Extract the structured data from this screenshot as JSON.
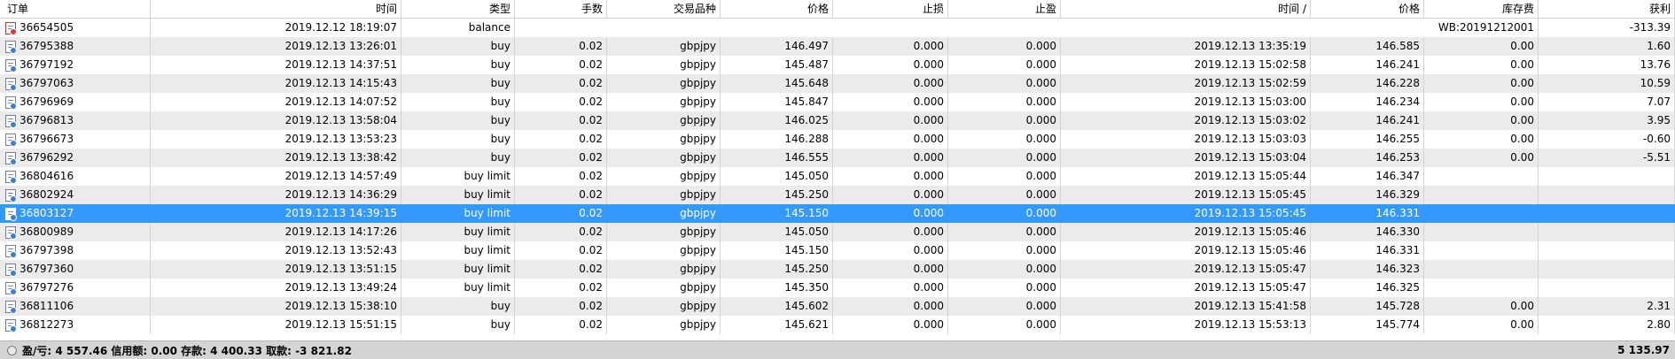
{
  "columns": [
    "订单",
    "时间",
    "类型",
    "手数",
    "交易品种",
    "价格",
    "止损",
    "止盈",
    "时间 /",
    "价格",
    "库存费",
    "获利"
  ],
  "balance_row": {
    "ticket": "36654505",
    "time": "2019.12.12 18:19:07",
    "type": "balance",
    "comment": "WB:20191212001",
    "profit": "-313.39"
  },
  "rows": [
    {
      "ticket": "36795388",
      "open_time": "2019.12.13 13:26:01",
      "type": "buy",
      "lots": "0.02",
      "symbol": "gbpjpy",
      "price": "146.497",
      "sl": "0.000",
      "tp": "0.000",
      "close_time": "2019.12.13 13:35:19",
      "close_price": "146.585",
      "swap": "0.00",
      "profit": "1.60"
    },
    {
      "ticket": "36797192",
      "open_time": "2019.12.13 14:37:51",
      "type": "buy",
      "lots": "0.02",
      "symbol": "gbpjpy",
      "price": "145.487",
      "sl": "0.000",
      "tp": "0.000",
      "close_time": "2019.12.13 15:02:58",
      "close_price": "146.241",
      "swap": "0.00",
      "profit": "13.76"
    },
    {
      "ticket": "36797063",
      "open_time": "2019.12.13 14:15:43",
      "type": "buy",
      "lots": "0.02",
      "symbol": "gbpjpy",
      "price": "145.648",
      "sl": "0.000",
      "tp": "0.000",
      "close_time": "2019.12.13 15:02:59",
      "close_price": "146.228",
      "swap": "0.00",
      "profit": "10.59"
    },
    {
      "ticket": "36796969",
      "open_time": "2019.12.13 14:07:52",
      "type": "buy",
      "lots": "0.02",
      "symbol": "gbpjpy",
      "price": "145.847",
      "sl": "0.000",
      "tp": "0.000",
      "close_time": "2019.12.13 15:03:00",
      "close_price": "146.234",
      "swap": "0.00",
      "profit": "7.07"
    },
    {
      "ticket": "36796813",
      "open_time": "2019.12.13 13:58:04",
      "type": "buy",
      "lots": "0.02",
      "symbol": "gbpjpy",
      "price": "146.025",
      "sl": "0.000",
      "tp": "0.000",
      "close_time": "2019.12.13 15:03:02",
      "close_price": "146.241",
      "swap": "0.00",
      "profit": "3.95"
    },
    {
      "ticket": "36796673",
      "open_time": "2019.12.13 13:53:23",
      "type": "buy",
      "lots": "0.02",
      "symbol": "gbpjpy",
      "price": "146.288",
      "sl": "0.000",
      "tp": "0.000",
      "close_time": "2019.12.13 15:03:03",
      "close_price": "146.255",
      "swap": "0.00",
      "profit": "-0.60"
    },
    {
      "ticket": "36796292",
      "open_time": "2019.12.13 13:38:42",
      "type": "buy",
      "lots": "0.02",
      "symbol": "gbpjpy",
      "price": "146.555",
      "sl": "0.000",
      "tp": "0.000",
      "close_time": "2019.12.13 15:03:04",
      "close_price": "146.253",
      "swap": "0.00",
      "profit": "-5.51"
    },
    {
      "ticket": "36804616",
      "open_time": "2019.12.13 14:57:49",
      "type": "buy limit",
      "lots": "0.02",
      "symbol": "gbpjpy",
      "price": "145.050",
      "sl": "0.000",
      "tp": "0.000",
      "close_time": "2019.12.13 15:05:44",
      "close_price": "146.347",
      "swap": "",
      "profit": ""
    },
    {
      "ticket": "36802924",
      "open_time": "2019.12.13 14:36:29",
      "type": "buy limit",
      "lots": "0.02",
      "symbol": "gbpjpy",
      "price": "145.250",
      "sl": "0.000",
      "tp": "0.000",
      "close_time": "2019.12.13 15:05:45",
      "close_price": "146.329",
      "swap": "",
      "profit": ""
    },
    {
      "ticket": "36803127",
      "open_time": "2019.12.13 14:39:15",
      "type": "buy limit",
      "lots": "0.02",
      "symbol": "gbpjpy",
      "price": "145.150",
      "sl": "0.000",
      "tp": "0.000",
      "close_time": "2019.12.13 15:05:45",
      "close_price": "146.331",
      "swap": "",
      "profit": "",
      "selected": true
    },
    {
      "ticket": "36800989",
      "open_time": "2019.12.13 14:17:26",
      "type": "buy limit",
      "lots": "0.02",
      "symbol": "gbpjpy",
      "price": "145.050",
      "sl": "0.000",
      "tp": "0.000",
      "close_time": "2019.12.13 15:05:46",
      "close_price": "146.330",
      "swap": "",
      "profit": ""
    },
    {
      "ticket": "36797398",
      "open_time": "2019.12.13 13:52:43",
      "type": "buy limit",
      "lots": "0.02",
      "symbol": "gbpjpy",
      "price": "145.150",
      "sl": "0.000",
      "tp": "0.000",
      "close_time": "2019.12.13 15:05:46",
      "close_price": "146.331",
      "swap": "",
      "profit": ""
    },
    {
      "ticket": "36797360",
      "open_time": "2019.12.13 13:51:15",
      "type": "buy limit",
      "lots": "0.02",
      "symbol": "gbpjpy",
      "price": "145.250",
      "sl": "0.000",
      "tp": "0.000",
      "close_time": "2019.12.13 15:05:47",
      "close_price": "146.323",
      "swap": "",
      "profit": ""
    },
    {
      "ticket": "36797276",
      "open_time": "2019.12.13 13:49:24",
      "type": "buy limit",
      "lots": "0.02",
      "symbol": "gbpjpy",
      "price": "145.350",
      "sl": "0.000",
      "tp": "0.000",
      "close_time": "2019.12.13 15:05:47",
      "close_price": "146.325",
      "swap": "",
      "profit": ""
    },
    {
      "ticket": "36811106",
      "open_time": "2019.12.13 15:38:10",
      "type": "buy",
      "lots": "0.02",
      "symbol": "gbpjpy",
      "price": "145.602",
      "sl": "0.000",
      "tp": "0.000",
      "close_time": "2019.12.13 15:41:58",
      "close_price": "145.728",
      "swap": "0.00",
      "profit": "2.31"
    },
    {
      "ticket": "36812273",
      "open_time": "2019.12.13 15:51:15",
      "type": "buy",
      "lots": "0.02",
      "symbol": "gbpjpy",
      "price": "145.621",
      "sl": "0.000",
      "tp": "0.000",
      "close_time": "2019.12.13 15:53:13",
      "close_price": "145.774",
      "swap": "0.00",
      "profit": "2.80"
    }
  ],
  "footer": {
    "summary": "盈/亏: 4 557.46  信用额: 0.00  存款: 4 400.33  取款: -3 821.82",
    "total": "5 135.97"
  },
  "colors": {
    "selected": "#3399ff",
    "alt_row": "#ebebeb",
    "footer": "#d4d4d4"
  }
}
